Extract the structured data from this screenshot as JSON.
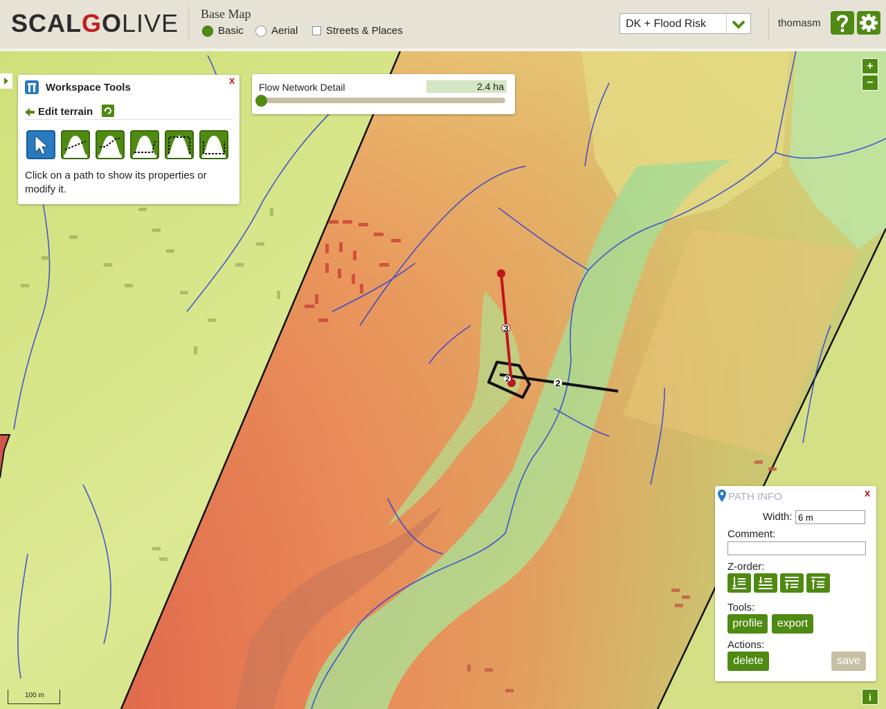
{
  "header": {
    "logo_bold": "SCAL",
    "logo_o": "G",
    "logo_o2": "O",
    "logo_light": "LIVE",
    "basemap_title": "Base Map",
    "basemap_options": [
      {
        "label": "Basic",
        "selected": true
      },
      {
        "label": "Aerial",
        "selected": false
      }
    ],
    "streets_label": "Streets & Places",
    "streets_checked": false,
    "layer_select": "DK + Flood Risk",
    "username": "thomasm",
    "help_icon": "question-icon",
    "settings_icon": "gear-icon"
  },
  "workspace_tools": {
    "title": "Workspace Tools",
    "close": "x",
    "edit_terrain_label": "Edit terrain",
    "tools": [
      "select-pointer-icon",
      "profile-line-icon",
      "ramp-line-icon",
      "valley-line-icon",
      "box-line-icon",
      "basin-line-icon"
    ],
    "help_text": "Click on a path to show its properties or modify it."
  },
  "flow_network": {
    "label": "Flow Network Detail",
    "value": "2.4 ha",
    "slider_fraction": 0.0
  },
  "map": {
    "path_markers": [
      "3",
      "2",
      "2"
    ],
    "scale_label": "100 m",
    "zoom_in": "+",
    "zoom_out": "−",
    "info_button": "i"
  },
  "path_info": {
    "title": "PATH INFO",
    "close": "x",
    "width_label": "Width:",
    "width_value": "6 m",
    "comment_label": "Comment:",
    "comment_value": "",
    "zorder_label": "Z-order:",
    "zorder_buttons": [
      "send-to-bottom-icon",
      "send-backward-icon",
      "bring-forward-icon",
      "bring-to-top-icon"
    ],
    "tools_label": "Tools:",
    "profile_label": "profile",
    "export_label": "export",
    "actions_label": "Actions:",
    "delete_label": "delete",
    "save_label": "save"
  },
  "colors": {
    "accent_green": "#4f8a12",
    "close_red": "#c31919",
    "path_red": "#c0141e",
    "stream_blue": "#2a3fd8"
  }
}
